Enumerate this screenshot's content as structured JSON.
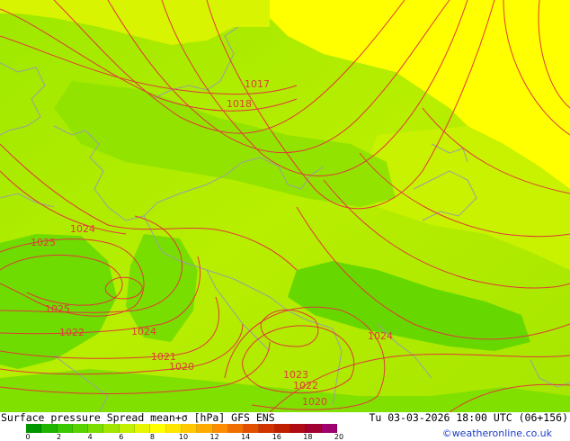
{
  "map": {
    "isobar_labels": [
      "1017",
      "1018",
      "1024",
      "1025",
      "1025",
      "1022",
      "1024",
      "1021",
      "1020",
      "1023",
      "1022",
      "1020",
      "1024"
    ],
    "colors": {
      "field_low": "#58d600",
      "field_mid": "#8ee600",
      "field_mid2": "#b8f000",
      "field_high": "#e8f800",
      "field_top": "#ffff00",
      "isobar": "#e03a3a",
      "coastline": "#9aa0a0"
    }
  },
  "title": {
    "left": "Surface pressure Spread mean+σ [hPa] GFS ENS",
    "right": "Tu 03-03-2026 18:00 UTC (06+156)"
  },
  "legend": {
    "ticks": [
      "0",
      "2",
      "4",
      "6",
      "8",
      "10",
      "12",
      "14",
      "16",
      "18",
      "20"
    ],
    "colors": [
      "#009600",
      "#1eb400",
      "#3cc800",
      "#5ad200",
      "#7cdc00",
      "#a0e600",
      "#c3f000",
      "#e6f500",
      "#ffff00",
      "#ffe600",
      "#ffc800",
      "#ffaa00",
      "#ff8c00",
      "#f06e00",
      "#e05000",
      "#d03200",
      "#c01e00",
      "#b00a14",
      "#a00032",
      "#a0006e"
    ],
    "credit": "©weatheronline.co.uk"
  }
}
